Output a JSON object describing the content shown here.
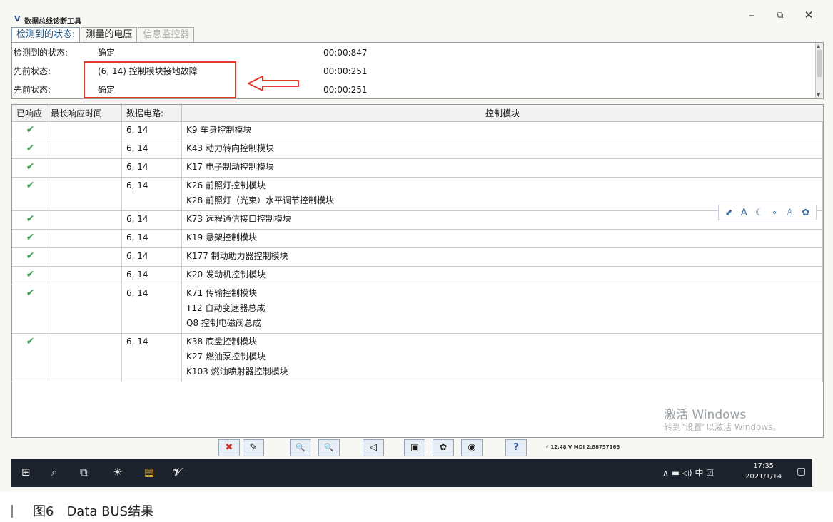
{
  "window": {
    "title": "数据总线诊断工具",
    "minimize": "–",
    "maximize": "⧉",
    "close": "✕"
  },
  "tabs": [
    {
      "label": "检测到的状态:"
    },
    {
      "label": "测量的电压"
    },
    {
      "label": "信息监控器"
    }
  ],
  "status_rows": [
    {
      "label": "检测到的状态:",
      "value": "确定",
      "time": "00:00:847"
    },
    {
      "label": "先前状态:",
      "value": "(6, 14) 控制模块接地故障",
      "time": "00:00:251"
    },
    {
      "label": "先前状态:",
      "value": "确定",
      "time": "00:00:251"
    }
  ],
  "table": {
    "headers": [
      "已响应",
      "最长响应时间",
      "数据电路:",
      "控制模块"
    ],
    "rows": [
      {
        "responded": "✔",
        "circuit": "6, 14",
        "modules": [
          "K9 车身控制模块"
        ]
      },
      {
        "responded": "✔",
        "circuit": "6, 14",
        "modules": [
          "K43 动力转向控制模块"
        ]
      },
      {
        "responded": "✔",
        "circuit": "6, 14",
        "modules": [
          "K17 电子制动控制模块"
        ]
      },
      {
        "responded": "✔",
        "circuit": "6, 14",
        "modules": [
          "K26 前照灯控制模块",
          "K28 前照灯（光束）水平调节控制模块"
        ]
      },
      {
        "responded": "✔",
        "circuit": "6, 14",
        "modules": [
          "K73 远程通信接口控制模块"
        ]
      },
      {
        "responded": "✔",
        "circuit": "6, 14",
        "modules": [
          "K19 悬架控制模块"
        ]
      },
      {
        "responded": "✔",
        "circuit": "6, 14",
        "modules": [
          "K177 制动助力器控制模块"
        ]
      },
      {
        "responded": "✔",
        "circuit": "6, 14",
        "modules": [
          "K20 发动机控制模块"
        ]
      },
      {
        "responded": "✔",
        "circuit": "6, 14",
        "modules": [
          "K71 传输控制模块",
          "T12 自动变速器总成",
          "Q8 控制电磁阀总成"
        ]
      },
      {
        "responded": "✔",
        "circuit": "6, 14",
        "modules": [
          "K38 底盘控制模块",
          "K27 燃油泵控制模块",
          "K103 燃油喷射器控制模块"
        ]
      }
    ]
  },
  "mini_toolbar": [
    "⬋",
    "A",
    "☾",
    "∘",
    "♙",
    "✿"
  ],
  "watermark": {
    "line1": "激活 Windows",
    "line2": "转到\"设置\"以激活 Windows。"
  },
  "toolbar": {
    "buttons": [
      "✖",
      "✎",
      "🔍",
      "🔍",
      "◁",
      "▣",
      "✿",
      "◉",
      "?"
    ],
    "voltage": "⚡ 12.48 V  MDI 2:88757168"
  },
  "taskbar": {
    "icons": [
      "⊞",
      "⌕",
      "⧉",
      "☀",
      "▤",
      "𝒱"
    ],
    "tray": "∧ ▬ ◁) 中 ☑",
    "time": "17:35",
    "date": "2021/1/14",
    "notify": "▢"
  },
  "caption": "图6　Data BUS结果",
  "colors": {
    "highlight": "#e03a2e",
    "check": "#3aa24a",
    "taskbar": "#1d232c"
  }
}
